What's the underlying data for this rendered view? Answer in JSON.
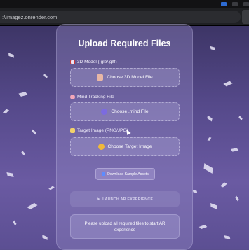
{
  "browser": {
    "url": "://imagez.onrender.com"
  },
  "upload": {
    "title": "Upload Required Files",
    "model": {
      "label": "3D Model (.glb/.gltf)",
      "button": "Choose 3D Model File"
    },
    "mind": {
      "label": "Mind Tracking File",
      "button": "Choose .mind File"
    },
    "target": {
      "label": "Target Image (PNG/JPG)",
      "button": "Choose Target Image"
    },
    "download_label": "Download Sample Assets",
    "launch_label": "LAUNCH AR EXPERIENCE",
    "notice": "Please upload all required files to start AR experience"
  },
  "colors": {
    "accent": "#5d8cff",
    "background": "#5a4f8e"
  }
}
